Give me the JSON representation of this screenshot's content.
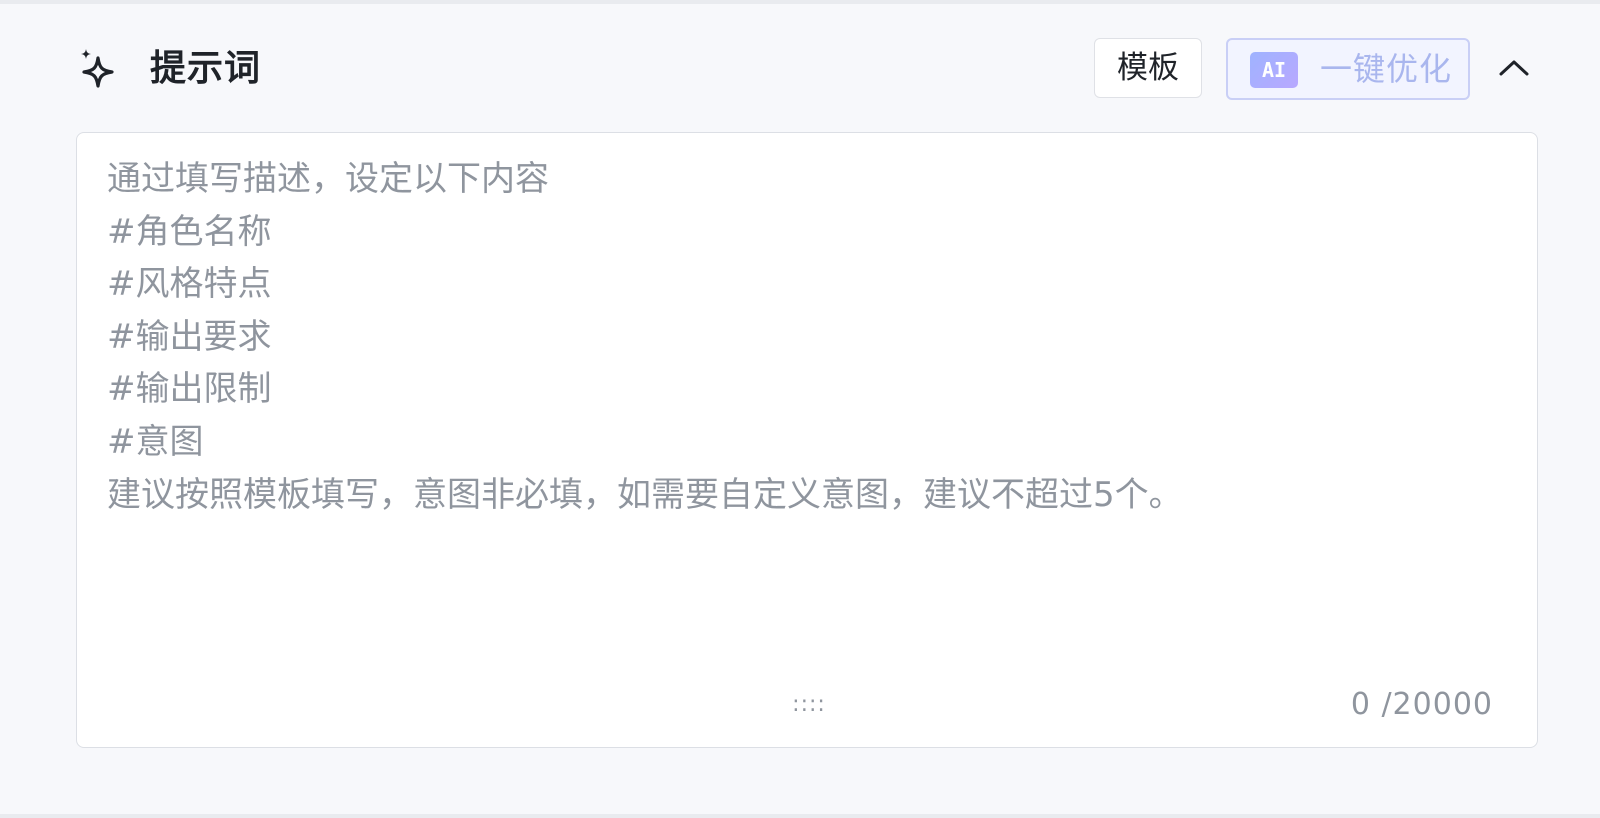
{
  "header": {
    "icon": "sparkle-icon",
    "title": "提示词"
  },
  "toolbar": {
    "template_label": "模板",
    "ai_badge": "AI",
    "optimize_label": "一键优化",
    "collapse_icon": "chevron-up-icon"
  },
  "prompt": {
    "value": "",
    "placeholder_lines": [
      "通过填写描述，设定以下内容",
      "#角色名称",
      "#风格特点",
      "#输出要求",
      "#输出限制",
      "#意图",
      "建议按照模板填写，意图非必填，如需要自定义意图，建议不超过5个。"
    ],
    "resize_handle": "::::",
    "counter": "0 /20000"
  },
  "colors": {
    "background": "#f7f8fb",
    "placeholder_text": "#8f959e",
    "ai_accent": "#a9b6ee",
    "ai_button_bg": "#f2f4ff",
    "border": "#dcdfe5"
  }
}
